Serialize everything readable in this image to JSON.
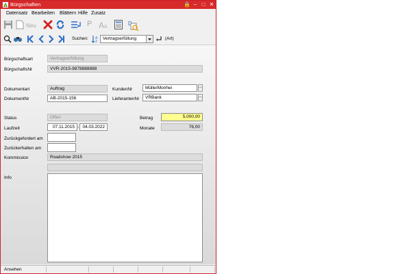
{
  "window": {
    "title": "Bürgschaften",
    "controls": {
      "lock": "🔒",
      "minimize": "–",
      "maximize": "□",
      "close": "✕"
    }
  },
  "menu": [
    "Datensatz",
    "Bearbeiten",
    "Blättern",
    "Hilfe",
    "Zusatz"
  ],
  "toolbar": {
    "new_label": "Neu",
    "p_label": "P"
  },
  "search": {
    "label": "Suchen:",
    "selected": "Vertragserfüllung",
    "mode": "(Art)"
  },
  "form": {
    "buergschaftsart_label": "Bürgschaftsart",
    "buergschaftsart_value": "Vertragserfüllung",
    "buergschaftsnr_label": "BürgschaftsNr",
    "buergschaftsnr_value": "VVR-2015-9878888888",
    "dokumentart_label": "Dokumentart",
    "dokumentart_value": "Auftrag",
    "kundennr_label": "KundenNr",
    "kundennr_value": "MüllerMonhei",
    "dokumentnr_label": "DokumentNr",
    "dokumentnr_value": "AB-2015-156",
    "lieferantennr_label": "LieferantenNr",
    "lieferantennr_value": "VRBank",
    "status_label": "Status",
    "status_value": "Offen",
    "betrag_label": "Betrag",
    "betrag_value": "5.000,00",
    "laufzeit_label": "Laufzeit",
    "laufzeit_from": "07.11.2015",
    "laufzeit_sep": "-",
    "laufzeit_to": "04.03.2022",
    "monate_label": "Monate",
    "monate_value": "76,00",
    "zurueckgefordert_label": "Zurückgefordert am",
    "zurueckgefordert_value": "",
    "zurueckerhalten_label": "Zurückerhalten am",
    "zurueckerhalten_value": "",
    "kommission_label": "Kommission",
    "kommission_value": "Roadshow 2015",
    "kommission2_value": "",
    "info_label": "Info",
    "ellipsis": "..."
  },
  "statusbar": {
    "mode": "Ansehen"
  },
  "colors": {
    "titlebar": "#d72a2a",
    "highlight": "#ffff8f",
    "nav_blue": "#2b6fc9"
  }
}
